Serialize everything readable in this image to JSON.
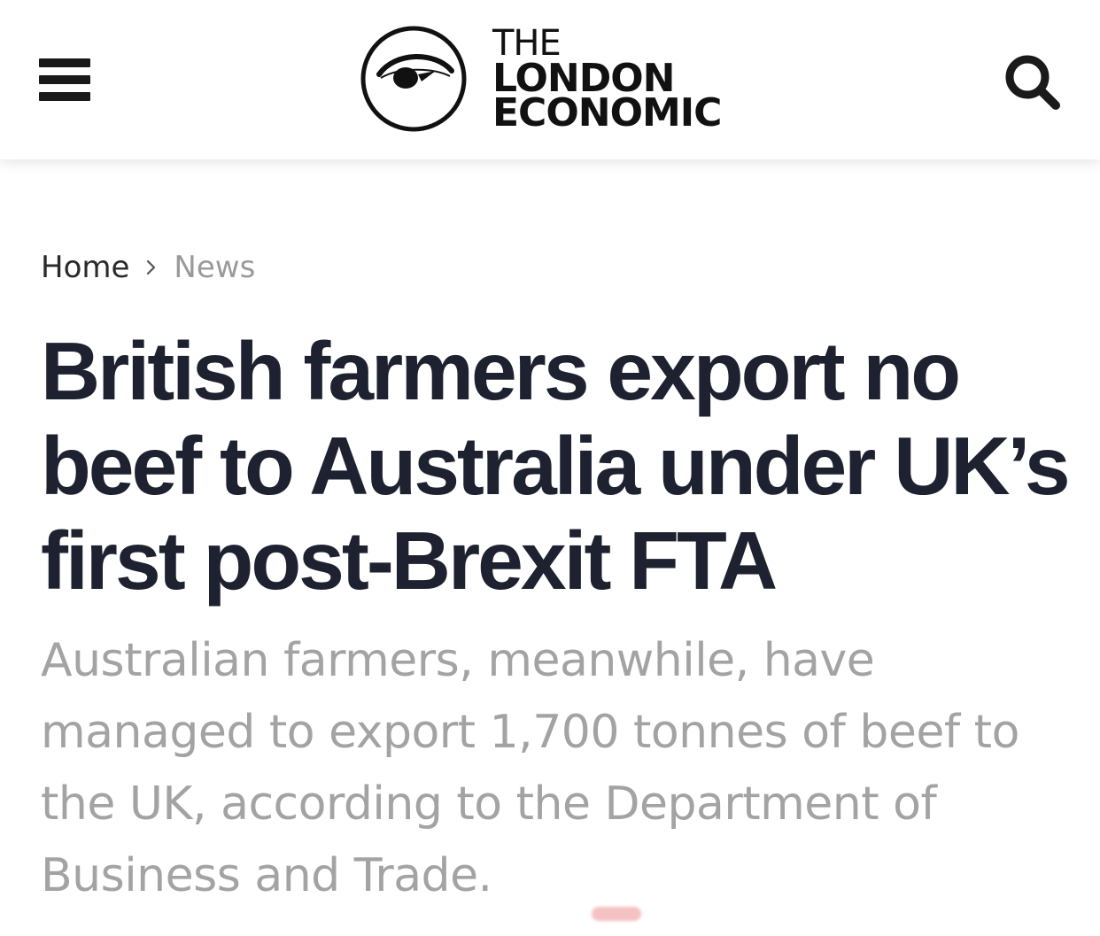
{
  "header": {
    "menu_icon": "hamburger-menu-icon",
    "logo": {
      "icon": "eye-icon",
      "line1": "THE",
      "line2": "LONDON",
      "line3": "ECONOMIC"
    },
    "search_icon": "search-icon"
  },
  "breadcrumb": {
    "home": "Home",
    "separator": "›",
    "current": "News"
  },
  "article": {
    "headline": "British farmers export no beef to Australia under UK’s first post-Brexit FTA",
    "subtitle": "Australian farmers, meanwhile, have managed to export 1,700 tonnes of beef to the UK, according to the Department of Business and Trade."
  },
  "colors": {
    "headline": "#1e2230",
    "subtitle": "#a3a3a3",
    "breadcrumb_current": "#9a9a9a",
    "icon": "#1a1a1a"
  }
}
